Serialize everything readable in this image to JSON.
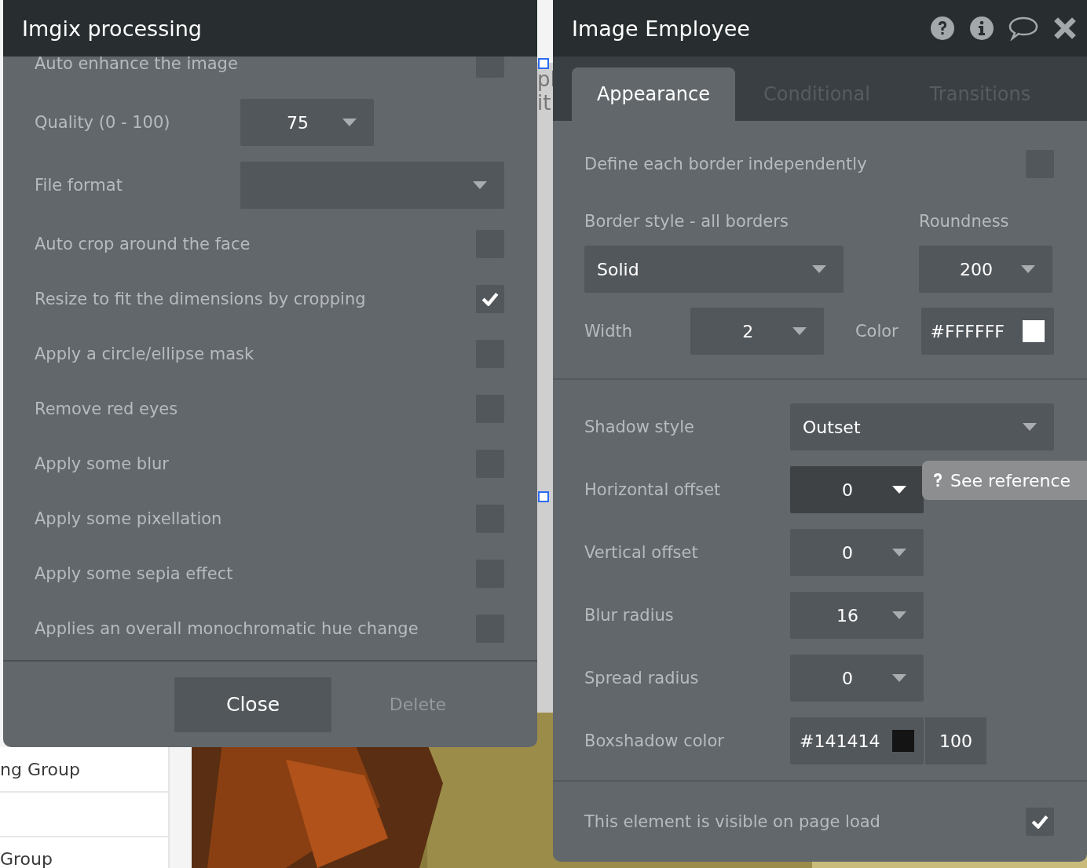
{
  "background": {
    "canvas_texts": [
      "pl",
      "it"
    ],
    "list_items": [
      {
        "kind": "item",
        "label": "ng Group"
      },
      {
        "kind": "blank"
      },
      {
        "kind": "item",
        "label": "Group"
      }
    ],
    "picture": {
      "kind": "picture"
    }
  },
  "imgix_panel": {
    "title": "Imgix processing",
    "rows": [
      {
        "kind": "checkbox",
        "label": "Auto enhance the image",
        "checked": false
      },
      {
        "kind": "dropdown",
        "label": "Quality (0 - 100)",
        "value": "75"
      },
      {
        "kind": "wide_dropdown",
        "label": "File format"
      },
      {
        "kind": "checkbox",
        "label": "Auto crop around the face",
        "checked": false
      },
      {
        "kind": "checkbox",
        "label": "Resize to fit the dimensions by cropping",
        "checked": true
      },
      {
        "kind": "checkbox",
        "label": "Apply a circle/ellipse mask",
        "checked": false
      },
      {
        "kind": "checkbox",
        "label": "Remove red eyes",
        "checked": false
      },
      {
        "kind": "checkbox",
        "label": "Apply some blur",
        "checked": false
      },
      {
        "kind": "checkbox",
        "label": "Apply some pixellation",
        "checked": false
      },
      {
        "kind": "checkbox",
        "label": "Apply some sepia effect",
        "checked": false
      },
      {
        "kind": "checkbox",
        "label": "Applies an overall monochromatic hue change",
        "checked": false
      }
    ],
    "buttons": [
      {
        "label": "Close",
        "disabled": false
      },
      {
        "label": "Delete",
        "disabled": true
      }
    ]
  },
  "property_editor": {
    "title": "Image Employee",
    "tabs": [
      {
        "label": "Appearance",
        "selected": true
      },
      {
        "label": "Conditional",
        "selected": false
      },
      {
        "label": "Transitions",
        "selected": false
      }
    ],
    "border": {
      "independent": {
        "label": "Define each border independently",
        "checked": false
      },
      "style": {
        "label": "Border style - all borders",
        "value": "Solid"
      },
      "roundness": {
        "label": "Roundness",
        "value": "200"
      },
      "width": {
        "label": "Width",
        "value": "2"
      },
      "color": {
        "label": "Color",
        "value": "#FFFFFF",
        "color": "#ffffff"
      }
    },
    "shadow": {
      "style": {
        "label": "Shadow style",
        "value": "Outset"
      },
      "fields": [
        {
          "label": "Horizontal offset",
          "value": "0",
          "hovered": true
        },
        {
          "label": "Vertical offset",
          "value": "0",
          "hovered": false
        },
        {
          "label": "Blur radius",
          "value": "16",
          "hovered": false
        },
        {
          "label": "Spread radius",
          "value": "0",
          "hovered": false
        }
      ],
      "color": {
        "label": "Boxshadow color",
        "value": "#141414",
        "color": "#141414",
        "opacity": "100"
      }
    },
    "visible": {
      "label": "This element is visible on page load",
      "checked": true
    },
    "tooltip": {
      "text": "See reference"
    }
  }
}
